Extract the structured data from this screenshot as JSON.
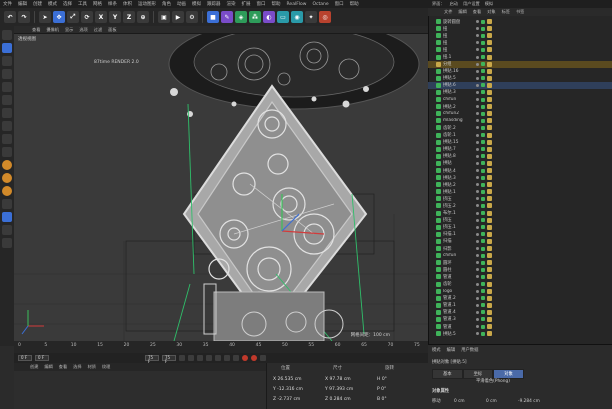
{
  "menubar": [
    "文件",
    "编辑",
    "创建",
    "模式",
    "选择",
    "工具",
    "网格",
    "样条",
    "体积",
    "运动图形",
    "角色",
    "动画",
    "模拟",
    "跟踪器",
    "渲染",
    "扩展",
    "窗口",
    "帮助",
    "RealFlow",
    "Octane",
    "窗口",
    "帮助"
  ],
  "toolbar_icons": [
    "undo-icon",
    "redo-icon",
    "move-icon",
    "scale-icon",
    "rotate-icon",
    "x-axis",
    "y-axis",
    "z-axis",
    "coord-icon",
    "render-view-icon",
    "render-icon",
    "render-settings-icon",
    "cube-icon",
    "pen-icon",
    "subdivide-icon",
    "array-icon",
    "deformer-icon",
    "floor-icon",
    "camera-icon",
    "light-icon",
    "octane-icon"
  ],
  "toolbar_axis": {
    "x": "X",
    "y": "Y",
    "z": "Z"
  },
  "viewport": {
    "menu": [
      "查看",
      "摄像机",
      "显示",
      "选项",
      "过滤",
      "面板"
    ],
    "title": "透视视图",
    "render_label": "87time RENDER 2.0",
    "grid_label": "网格间距：100 cm"
  },
  "timeline": {
    "ticks": [
      "0",
      "5",
      "10",
      "15",
      "20",
      "25",
      "30",
      "35",
      "40",
      "45",
      "50",
      "55",
      "60",
      "65",
      "70",
      "75"
    ],
    "start_field": "0 F",
    "current_field": "0 F",
    "end_field": "75 F",
    "end2_field": "75 F"
  },
  "material_menu": [
    "创建",
    "编辑",
    "查看",
    "选择",
    "材质",
    "纹理"
  ],
  "coords": {
    "headers": [
      "位置",
      "尺寸",
      "旋转"
    ],
    "rows": [
      {
        "pos": "X  26.535 cm",
        "size": "X  97.78 cm",
        "rot": "H  0°"
      },
      {
        "pos": "Y  -12.316 cm",
        "size": "Y  97.393 cm",
        "rot": "P  0°"
      },
      {
        "pos": "Z  -2.737 cm",
        "size": "Z  0.284 cm",
        "rot": "B  0°"
      }
    ]
  },
  "right_top": [
    "界面：",
    "启动",
    "用户设置",
    "模拟"
  ],
  "right_tabs": [
    "文件",
    "编辑",
    "查看",
    "对象",
    "标签",
    "书签"
  ],
  "objects": [
    {
      "name": "旋转圆盘",
      "color": "#3fb35a"
    },
    {
      "name": "扭",
      "color": "#3fb35a"
    },
    {
      "name": "扭",
      "color": "#3fb35a"
    },
    {
      "name": "扭",
      "color": "#3fb35a"
    },
    {
      "name": "扭",
      "color": "#3fb35a"
    },
    {
      "name": "扭.1",
      "color": "#3fb35a"
    },
    {
      "name": "分组",
      "color": "#c9a84a",
      "hl": true
    },
    {
      "name": "拼贴.16",
      "color": "#3fb35a"
    },
    {
      "name": "拼贴.5",
      "color": "#3fb35a"
    },
    {
      "name": "拼贴.6",
      "color": "#3fb35a",
      "sel": true
    },
    {
      "name": "拼贴.3",
      "color": "#3fb35a"
    },
    {
      "name": "chifun",
      "color": "#3fb35a"
    },
    {
      "name": "拼贴.2",
      "color": "#3fb35a"
    },
    {
      "name": "chifun2",
      "color": "#3fb35a"
    },
    {
      "name": "mlasding",
      "color": "#3fb35a"
    },
    {
      "name": "齿轮.2",
      "color": "#3fb35a"
    },
    {
      "name": "齿轮.1",
      "color": "#3fb35a"
    },
    {
      "name": "拼贴.15",
      "color": "#3fb35a"
    },
    {
      "name": "拼贴.7",
      "color": "#3fb35a"
    },
    {
      "name": "拼贴.8",
      "color": "#3fb35a"
    },
    {
      "name": "拼贴",
      "color": "#3fb35a"
    },
    {
      "name": "拼贴.4",
      "color": "#3fb35a"
    },
    {
      "name": "拼贴.3",
      "color": "#3fb35a"
    },
    {
      "name": "拼贴.2",
      "color": "#3fb35a"
    },
    {
      "name": "拼贴.1",
      "color": "#3fb35a"
    },
    {
      "name": "挤压",
      "color": "#3fb35a"
    },
    {
      "name": "挤压.2",
      "color": "#3fb35a"
    },
    {
      "name": "布尔.1",
      "color": "#3fb35a"
    },
    {
      "name": "挤压",
      "color": "#3fb35a"
    },
    {
      "name": "挤压.1",
      "color": "#3fb35a"
    },
    {
      "name": "扫描.1",
      "color": "#3fb35a"
    },
    {
      "name": "扫描",
      "color": "#3fb35a"
    },
    {
      "name": "扫影",
      "color": "#3fb35a"
    },
    {
      "name": "chifun",
      "color": "#3fb35a"
    },
    {
      "name": "圆环",
      "color": "#3fb35a"
    },
    {
      "name": "圆柱",
      "color": "#3fb35a"
    },
    {
      "name": "管道",
      "color": "#3fb35a"
    },
    {
      "name": "齿轮",
      "color": "#3fb35a"
    },
    {
      "name": "logo",
      "color": "#3fb35a"
    },
    {
      "name": "管道.2",
      "color": "#3fb35a"
    },
    {
      "name": "管道.1",
      "color": "#3fb35a"
    },
    {
      "name": "管道.4",
      "color": "#3fb35a"
    },
    {
      "name": "管道.3",
      "color": "#3fb35a"
    },
    {
      "name": "管道",
      "color": "#3fb35a"
    },
    {
      "name": "拼贴.5",
      "color": "#3fb35a"
    }
  ],
  "attributes": {
    "menu": [
      "模式",
      "编辑",
      "用户数据"
    ],
    "object_label": "拼贴对象 [拼贴.5]",
    "tabs": [
      "基本",
      "坐标",
      "对象"
    ],
    "tab_extra": "平滑着色(Phong)",
    "section": "对象属性",
    "move_label": "移动",
    "move_values": [
      "0 cm",
      "0 cm",
      "-9.284 cm"
    ]
  }
}
